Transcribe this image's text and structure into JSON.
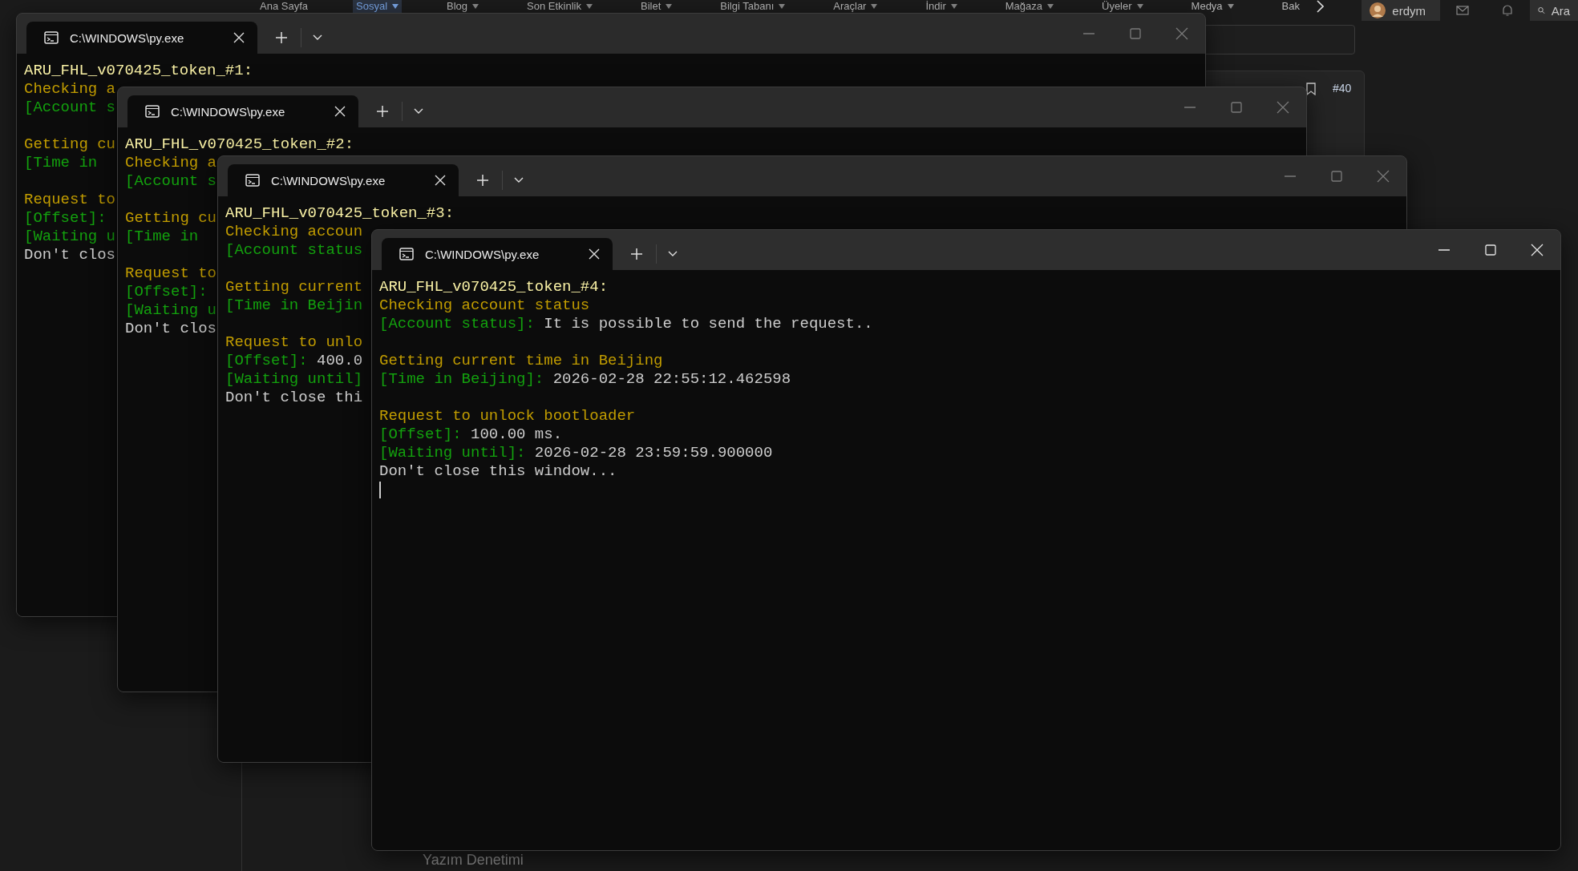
{
  "forum": {
    "nav": [
      {
        "label": "Ana Sayfa",
        "selected": false,
        "has_menu": false
      },
      {
        "label": "Sosyal",
        "selected": true,
        "has_menu": true
      },
      {
        "label": "Blog",
        "selected": false,
        "has_menu": true
      },
      {
        "label": "Son Etkinlik",
        "selected": false,
        "has_menu": true
      },
      {
        "label": "Bilet",
        "selected": false,
        "has_menu": true
      },
      {
        "label": "Bilgi Tabanı",
        "selected": false,
        "has_menu": true
      },
      {
        "label": "Araçlar",
        "selected": false,
        "has_menu": true
      },
      {
        "label": "İndir",
        "selected": false,
        "has_menu": true
      },
      {
        "label": "Mağaza",
        "selected": false,
        "has_menu": true
      },
      {
        "label": "Üyeler",
        "selected": false,
        "has_menu": true
      },
      {
        "label": "Medya",
        "selected": false,
        "has_menu": true
      },
      {
        "label": "Bak",
        "selected": false,
        "has_menu": false
      }
    ],
    "user": {
      "name": "erdym"
    },
    "search": {
      "label": "Ara"
    },
    "post": {
      "number": "#40"
    },
    "footer_link": "Yazım Denetimi"
  },
  "windows": [
    {
      "tab_title": "C:\\WINDOWS\\py.exe",
      "active": false,
      "cursor": false,
      "lines": [
        {
          "kind": "title",
          "text": "ARU_FHL_v070425_token_#1:"
        },
        {
          "kind": "step",
          "text": "Checking a"
        },
        {
          "kind": "field",
          "label": "[Account s"
        },
        {
          "kind": "blank"
        },
        {
          "kind": "step",
          "text": "Getting cu"
        },
        {
          "kind": "field",
          "label": "[Time in"
        },
        {
          "kind": "blank"
        },
        {
          "kind": "step",
          "text": "Request to"
        },
        {
          "kind": "field",
          "label": "[Offset]:"
        },
        {
          "kind": "field",
          "label": "[Waiting u"
        },
        {
          "kind": "plain",
          "text": "Don't clos"
        }
      ]
    },
    {
      "tab_title": "C:\\WINDOWS\\py.exe",
      "active": false,
      "cursor": false,
      "lines": [
        {
          "kind": "title",
          "text": "ARU_FHL_v070425_token_#2:"
        },
        {
          "kind": "step",
          "text": "Checking a"
        },
        {
          "kind": "field",
          "label": "[Account s"
        },
        {
          "kind": "blank"
        },
        {
          "kind": "step",
          "text": "Getting cu"
        },
        {
          "kind": "field",
          "label": "[Time in"
        },
        {
          "kind": "blank"
        },
        {
          "kind": "step",
          "text": "Request to"
        },
        {
          "kind": "field",
          "label": "[Offset]:"
        },
        {
          "kind": "field",
          "label": "[Waiting u"
        },
        {
          "kind": "plain",
          "text": "Don't clos"
        }
      ]
    },
    {
      "tab_title": "C:\\WINDOWS\\py.exe",
      "active": false,
      "cursor": false,
      "lines": [
        {
          "kind": "title",
          "text": "ARU_FHL_v070425_token_#3:"
        },
        {
          "kind": "step",
          "text": "Checking accoun"
        },
        {
          "kind": "field",
          "label": "[Account status"
        },
        {
          "kind": "blank"
        },
        {
          "kind": "step",
          "text": "Getting current"
        },
        {
          "kind": "field",
          "label": "[Time in Beijin"
        },
        {
          "kind": "blank"
        },
        {
          "kind": "step",
          "text": "Request to unlo"
        },
        {
          "kind": "field",
          "label": "[Offset]:",
          "value": "400.0"
        },
        {
          "kind": "field",
          "label": "[Waiting until]"
        },
        {
          "kind": "plain",
          "text": "Don't close thi"
        }
      ]
    },
    {
      "tab_title": "C:\\WINDOWS\\py.exe",
      "active": true,
      "cursor": true,
      "lines": [
        {
          "kind": "title",
          "text": "ARU_FHL_v070425_token_#4:"
        },
        {
          "kind": "step",
          "text": "Checking account status"
        },
        {
          "kind": "field",
          "label": "[Account status]:",
          "value": "It is possible to send the request.."
        },
        {
          "kind": "blank"
        },
        {
          "kind": "step",
          "text": "Getting current time in Beijing"
        },
        {
          "kind": "field",
          "label": "[Time in Beijing]:",
          "value": "2026-02-28 22:55:12.462598"
        },
        {
          "kind": "blank"
        },
        {
          "kind": "step",
          "text": "Request to unlock bootloader"
        },
        {
          "kind": "field",
          "label": "[Offset]:",
          "value": "100.00 ms."
        },
        {
          "kind": "field",
          "label": "[Waiting until]:",
          "value": "2026-02-28 23:59:59.900000"
        },
        {
          "kind": "plain",
          "text": "Don't close this window..."
        }
      ]
    }
  ]
}
